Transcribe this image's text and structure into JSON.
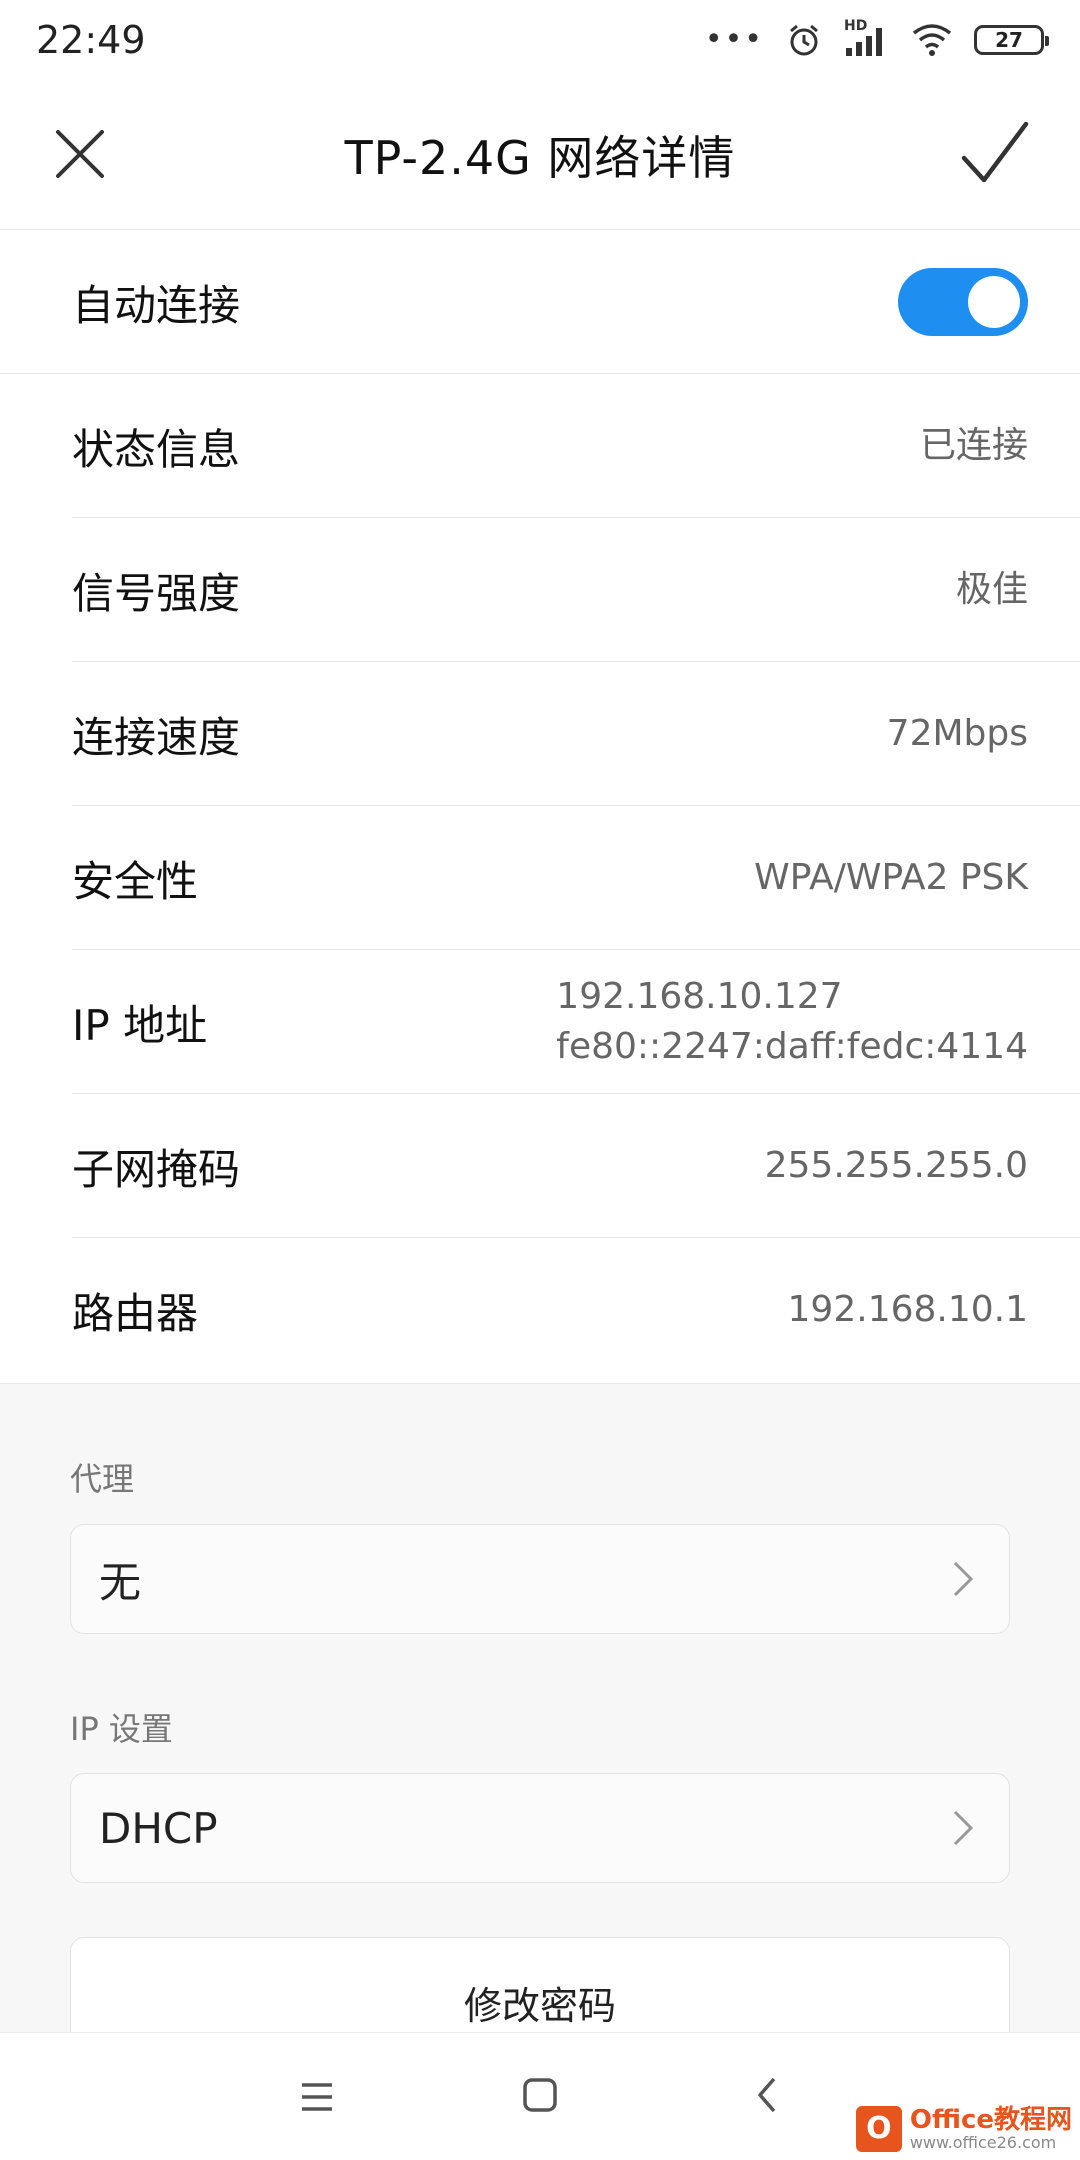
{
  "status_bar": {
    "time": "22:49",
    "signal_label": "HD",
    "battery": "27",
    "icons": [
      "more-dots-icon",
      "alarm-icon",
      "signal-icon",
      "wifi-icon",
      "battery-icon"
    ]
  },
  "header": {
    "title": "TP-2.4G  网络详情",
    "close_icon": "close-icon",
    "confirm_icon": "check-icon"
  },
  "rows": {
    "auto_connect": {
      "label": "自动连接",
      "enabled": true
    },
    "status": {
      "label": "状态信息",
      "value": "已连接"
    },
    "signal": {
      "label": "信号强度",
      "value": "极佳"
    },
    "speed": {
      "label": "连接速度",
      "value": "72Mbps"
    },
    "security": {
      "label": "安全性",
      "value": "WPA/WPA2 PSK"
    },
    "ip": {
      "label": "IP 地址",
      "value_v4": "192.168.10.127",
      "value_v6": "fe80::2247:daff:fedc:4114"
    },
    "subnet": {
      "label": "子网掩码",
      "value": "255.255.255.0"
    },
    "router": {
      "label": "路由器",
      "value": "192.168.10.1"
    }
  },
  "proxy": {
    "label": "代理",
    "value": "无"
  },
  "ip_settings": {
    "label": "IP 设置",
    "value": "DHCP"
  },
  "change_password": {
    "label": "修改密码"
  },
  "nav_bar": {
    "icons": [
      "menu-icon",
      "home-icon",
      "back-icon"
    ]
  },
  "watermark": {
    "main": "Office教程网",
    "sub": "www.office26.com"
  },
  "colors": {
    "accent": "#1e8ff0",
    "gray_bg": "#f7f7f7",
    "watermark": "#e8541d"
  }
}
